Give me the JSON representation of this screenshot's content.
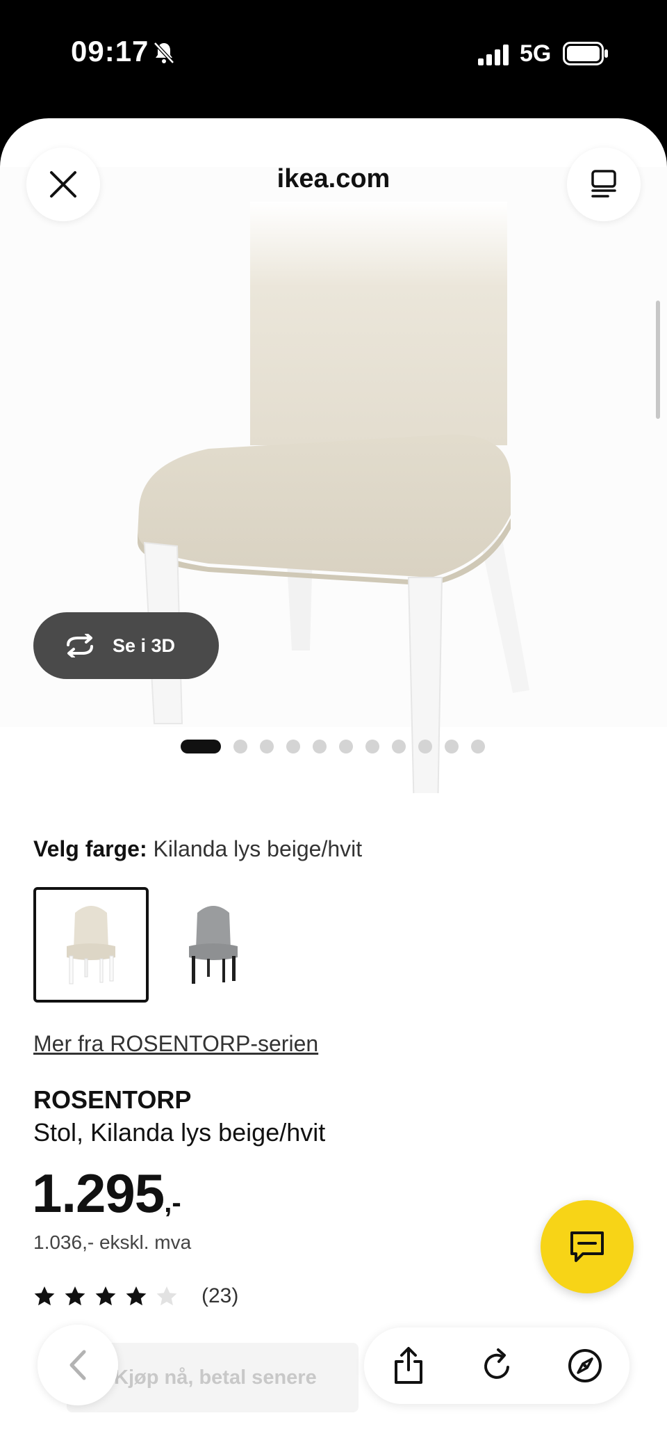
{
  "status_bar": {
    "time": "09:17",
    "network": "5G",
    "icons": [
      "bell-slash-icon",
      "signal-icon",
      "battery-icon"
    ]
  },
  "browser": {
    "site_title": "ikea.com",
    "close_icon": "close-icon",
    "tabs_icon": "tabs-icon"
  },
  "gallery": {
    "view_3d_label": "Se i 3D",
    "image_count": 11,
    "active_index": 0
  },
  "color": {
    "label": "Velg farge:",
    "value": "Kilanda lys beige/hvit",
    "options": [
      {
        "seat": "#e6e0d2",
        "legs": "#ffffff",
        "selected": true
      },
      {
        "seat": "#8e9092",
        "legs": "#1f1f1f",
        "selected": false
      }
    ]
  },
  "product": {
    "series_link": "Mer fra ROSENTORP-serien",
    "name": "ROSENTORP",
    "description": "Stol, Kilanda lys beige/hvit",
    "price_main": "1.295",
    "price_suffix": ",-",
    "price_ex_vat": "1.036,- ekskl. mva",
    "rating": 4,
    "rating_max": 5,
    "review_count": "(23)"
  },
  "bottom": {
    "bnpl_label": "Kjøp nå, betal senere"
  },
  "colors": {
    "accent_yellow": "#f7d417",
    "dark_button": "#4a4a4a"
  }
}
